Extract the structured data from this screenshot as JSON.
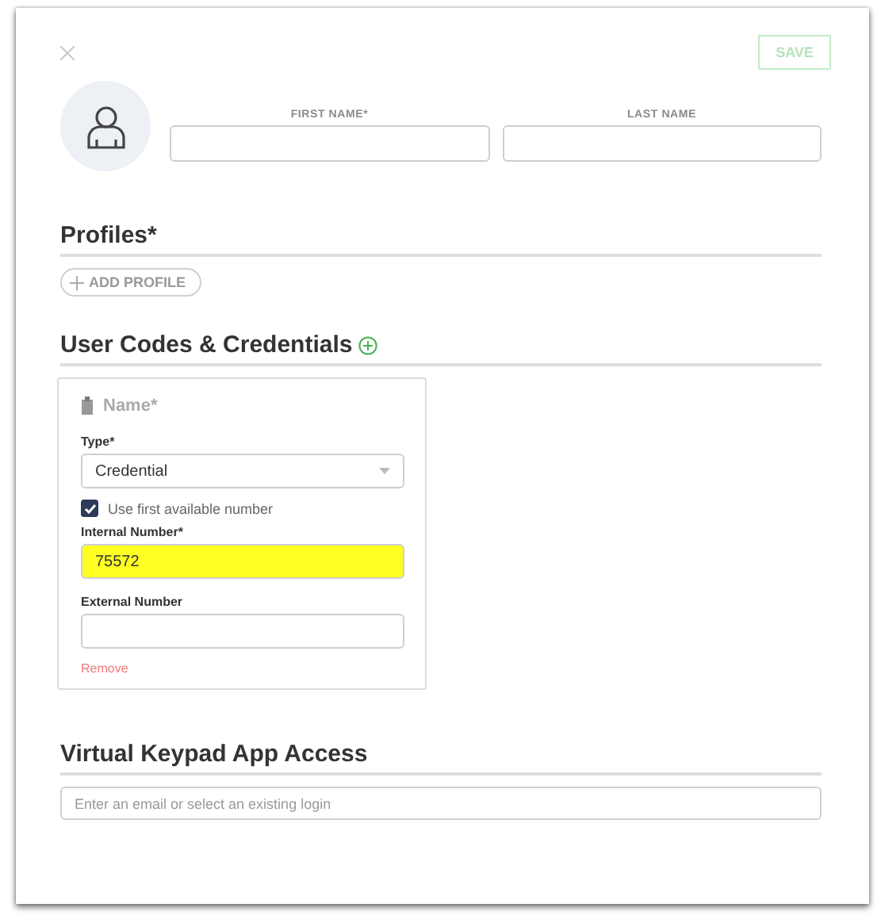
{
  "save_button": {
    "label": "SAVE",
    "disabled": true
  },
  "name_fields": [
    {
      "label": "FIRST NAME*"
    },
    {
      "label": "LAST NAME"
    }
  ],
  "profiles": {
    "title": "Profiles*",
    "add_button": "ADD PROFILE"
  },
  "credentials": {
    "title": "User Codes & Credentials",
    "card": {
      "name_placeholder": "Name*",
      "type_label": "Type*",
      "type_value": "Credential",
      "checkbox": {
        "label": "Use first available number",
        "checked": true
      },
      "internal_label": "Internal Number*",
      "internal_value": "75572",
      "internal_highlighted": true,
      "external_label": "External Number",
      "remove": "Remove"
    }
  },
  "keypad": {
    "title": "Virtual Keypad App Access",
    "placeholder": "Enter an email or select an existing login"
  }
}
